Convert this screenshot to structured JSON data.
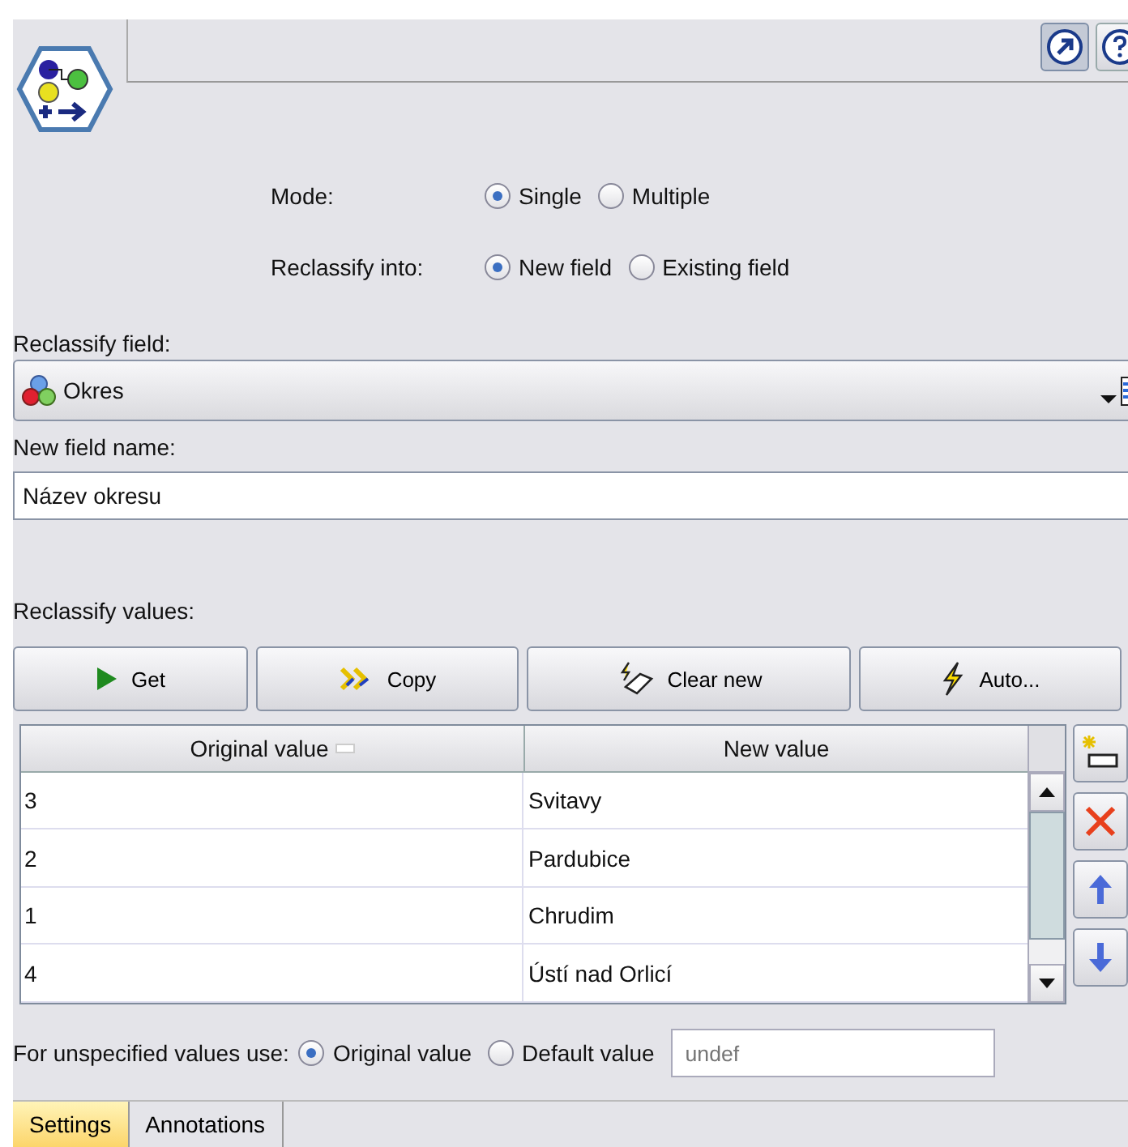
{
  "radio_groups": [
    {
      "label": "Mode:",
      "options": [
        {
          "label": "Single",
          "selected": true
        },
        {
          "label": "Multiple",
          "selected": false
        }
      ]
    },
    {
      "label": "Reclassify into:",
      "options": [
        {
          "label": "New field",
          "selected": true
        },
        {
          "label": "Existing field",
          "selected": false
        }
      ]
    }
  ],
  "reclassify_field": {
    "label": "Reclassify field:",
    "value": "Okres"
  },
  "new_field_name": {
    "label": "New field name:",
    "value": "Název okresu"
  },
  "reclassify_values": {
    "label": "Reclassify values:",
    "buttons": [
      {
        "label": "Get",
        "kind": "play"
      },
      {
        "label": "Copy",
        "kind": "copy"
      },
      {
        "label": "Clear new",
        "kind": "clear"
      },
      {
        "label": "Auto...",
        "kind": "auto"
      }
    ],
    "table": {
      "columns": [
        "Original value",
        "New value"
      ],
      "rows": [
        [
          "3",
          "Svitavy"
        ],
        [
          "2",
          "Pardubice"
        ],
        [
          "1",
          "Chrudim"
        ],
        [
          "4",
          "Ústí nad Orlicí"
        ]
      ]
    },
    "side_buttons": [
      {
        "kind": "add"
      },
      {
        "kind": "delete"
      },
      {
        "kind": "up"
      },
      {
        "kind": "down"
      }
    ]
  },
  "unspecified": {
    "label": "For unspecified values use:",
    "options": [
      {
        "label": "Original value",
        "selected": true
      },
      {
        "label": "Default value",
        "selected": false
      }
    ],
    "placeholder": "undef"
  },
  "tabs": [
    {
      "label": "Settings",
      "selected": true
    },
    {
      "label": "Annotations",
      "selected": false
    }
  ]
}
